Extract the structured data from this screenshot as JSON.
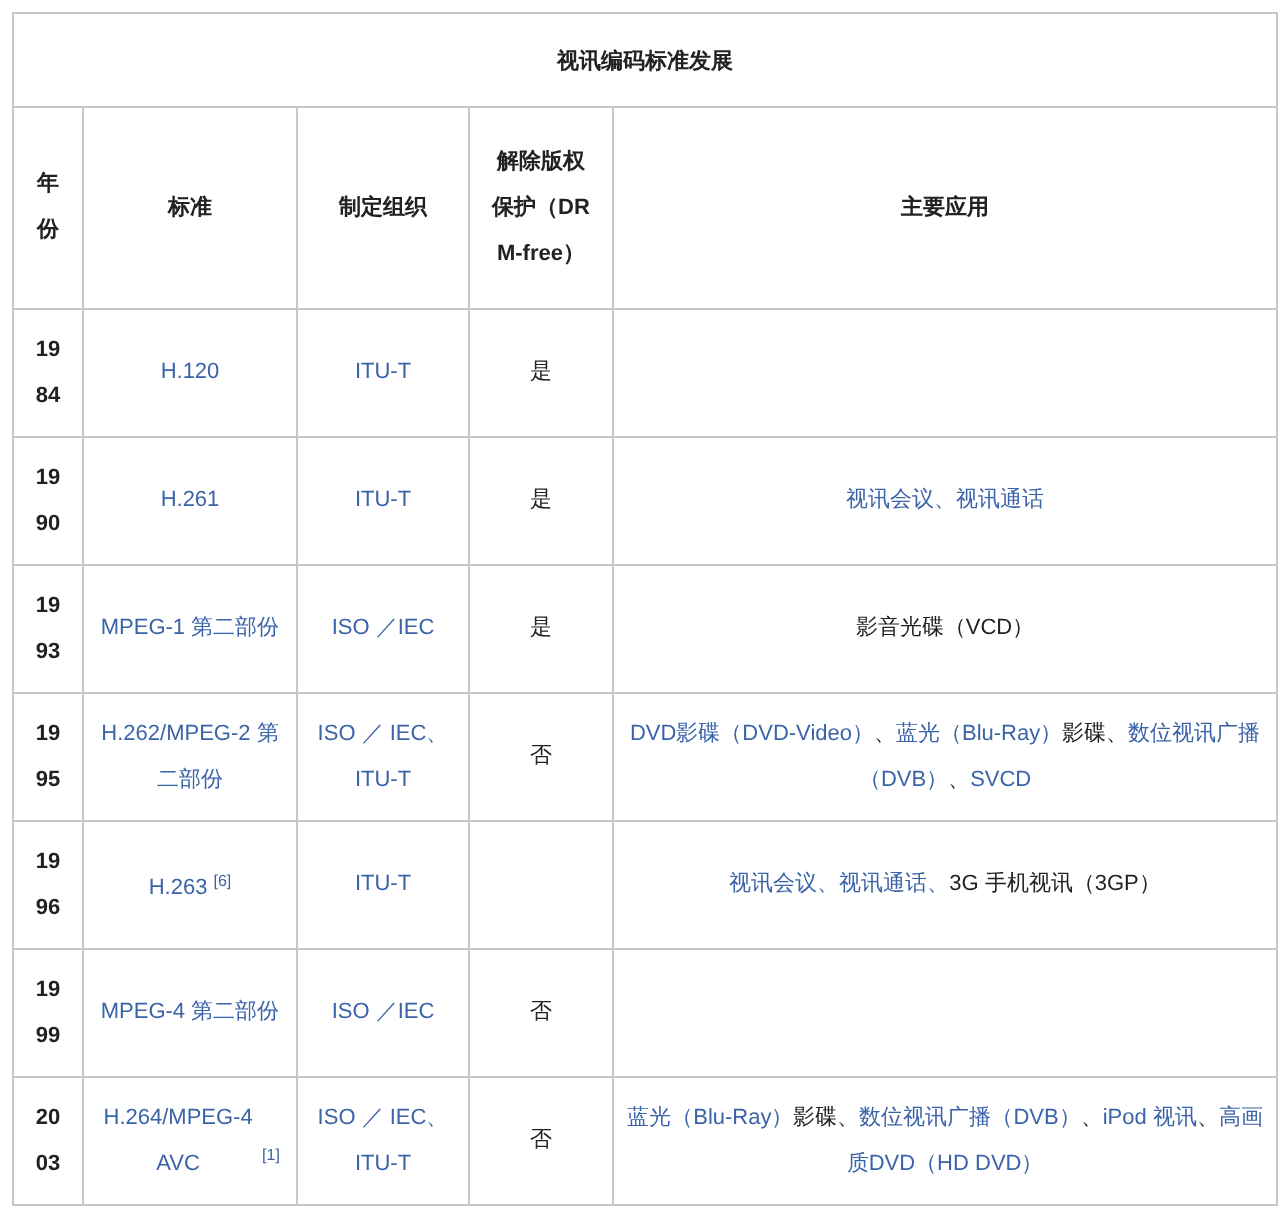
{
  "table": {
    "caption": "视讯编码标准发展",
    "columns": [
      "年份",
      "标准",
      "制定组织",
      "解除版权保护（DRM-free）",
      "主要应用"
    ],
    "rows": [
      {
        "year": "1984",
        "standard": "H.120",
        "org": "ITU-T",
        "drm_free": "是",
        "apps": []
      },
      {
        "year": "1990",
        "standard": "H.261",
        "org": "ITU-T",
        "drm_free": "是",
        "apps": [
          {
            "text": "视讯会议、视讯通话",
            "link": true
          }
        ]
      },
      {
        "year": "1993",
        "standard": "MPEG-1 第二部份",
        "org": "ISO ／IEC",
        "drm_free": "是",
        "apps": [
          {
            "text": "影音光碟（VCD）",
            "link": false
          }
        ]
      },
      {
        "year": "1995",
        "standard": "H.262/MPEG-2 第二部份",
        "org": "ISO ／ IEC、ITU-T",
        "drm_free": "否",
        "apps": [
          {
            "text": "DVD影碟（DVD-Video）",
            "link": true
          },
          {
            "text": "、",
            "link": false
          },
          {
            "text": "蓝光（Blu-Ray）",
            "link": true
          },
          {
            "text": "影碟、",
            "link": false
          },
          {
            "text": "数位视讯广播（DVB）",
            "link": true
          },
          {
            "text": "、",
            "link": false
          },
          {
            "text": "SVCD",
            "link": true
          }
        ]
      },
      {
        "year": "1996",
        "standard": "H.263",
        "note": "[6]",
        "org": "ITU-T",
        "drm_free": "",
        "apps": [
          {
            "text": "视讯会议、视讯通话、",
            "link": true
          },
          {
            "text": "3G 手机视讯（3GP）",
            "link": false
          }
        ]
      },
      {
        "year": "1999",
        "standard": "MPEG-4 第二部份",
        "org": "ISO ／IEC",
        "drm_free": "否",
        "apps": []
      },
      {
        "year": "2003",
        "standard": "H.264/MPEG-4 AVC",
        "note": "[1]",
        "org": "ISO ／ IEC、ITU-T",
        "drm_free": "否",
        "apps": [
          {
            "text": "蓝光（Blu-Ray）",
            "link": true
          },
          {
            "text": "影碟、",
            "link": false
          },
          {
            "text": "数位视讯广播（DVB）",
            "link": true
          },
          {
            "text": "、",
            "link": false
          },
          {
            "text": "iPod 视讯",
            "link": true
          },
          {
            "text": "、",
            "link": false
          },
          {
            "text": "高画质DVD（HD DVD）",
            "link": true
          }
        ]
      }
    ]
  }
}
